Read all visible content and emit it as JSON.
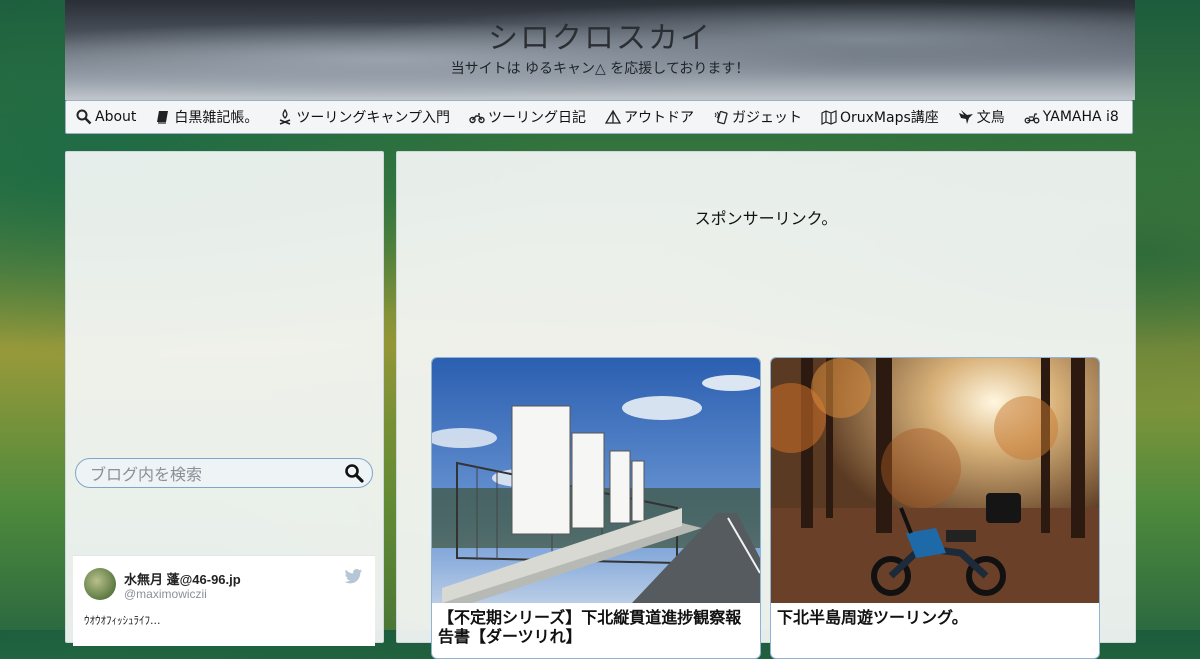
{
  "header": {
    "title": "シロクロスカイ",
    "subtitle": "当サイトは ゆるキャン△ を応援しております！"
  },
  "nav": {
    "items": [
      {
        "label": "About",
        "icon": "search-icon"
      },
      {
        "label": "白黒雑記帳。",
        "icon": "book-icon"
      },
      {
        "label": "ツーリングキャンプ入門",
        "icon": "campfire-icon"
      },
      {
        "label": "ツーリング日記",
        "icon": "motorcycle-icon"
      },
      {
        "label": "アウトドア",
        "icon": "tent-icon"
      },
      {
        "label": "ガジェット",
        "icon": "gadget-icon"
      },
      {
        "label": "OruxMaps講座",
        "icon": "map-icon"
      },
      {
        "label": "文鳥",
        "icon": "bird-icon"
      },
      {
        "label": "YAMAHA i8",
        "icon": "scooter-icon"
      }
    ]
  },
  "sidebar": {
    "search": {
      "placeholder": "ブログ内を検索"
    },
    "twitter": {
      "name": "水無月 蓬@46-96.jp",
      "handle": "@maximowiczii",
      "text": "ｳｵｳｵﾌｨｯｼｭﾗｲﾌ..."
    }
  },
  "main": {
    "sponsor_label": "スポンサーリンク。",
    "cards": [
      {
        "title": "【不定期シリーズ】下北縦貫道進捗観察報告書【ダーツリれ】"
      },
      {
        "title": "下北半島周遊ツーリング。"
      }
    ]
  },
  "colors": {
    "nav_border": "#9fb0c4",
    "card_border": "#8fb3d6",
    "search_border": "#7fa6c9"
  }
}
